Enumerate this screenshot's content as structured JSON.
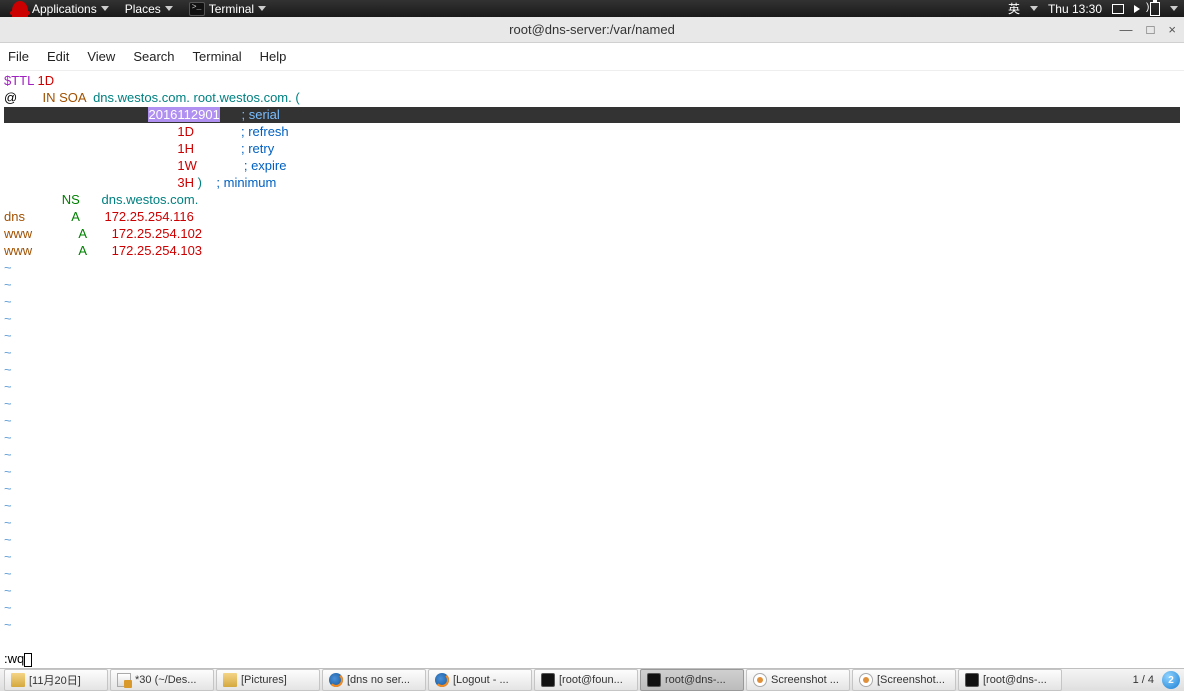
{
  "top_panel": {
    "apps": "Applications",
    "places": "Places",
    "terminal": "Terminal",
    "ime": "英",
    "clock": "Thu 13:30"
  },
  "window": {
    "title": "root@dns-server:/var/named",
    "menu": {
      "file": "File",
      "edit": "Edit",
      "view": "View",
      "search": "Search",
      "terminal": "Terminal",
      "help": "Help"
    }
  },
  "vim": {
    "l1a": "$TTL ",
    "l1b": "1D",
    "l2a": "@       ",
    "l2b": "IN SOA",
    "l2c": "  dns.westos.com. root.westos.com. (",
    "hl_pad": "                                        ",
    "hl_serial": "2016112901",
    "hl_sp": "      ",
    "hl_semi": "; ",
    "hl_word": "serial",
    "l4v": "1D",
    "l4c": "; refresh",
    "l5v": "1H",
    "l5c": "; retry",
    "l6v": "1W",
    "l6c": "; expire",
    "l7v": "3H",
    "l7p": " )    ",
    "l7c": "; minimum",
    "l8a": "                ",
    "l8b": "NS",
    "l8c": "      dns.westos.com.",
    "l9a": "dns",
    "l9p": "             ",
    "l9b": "A",
    "l9c": "       172.25.254.116",
    "l10a": "www",
    "l10p": "             ",
    "l10b": "A",
    "l10c": "       172.25.254.102",
    "l11a": "www",
    "l11p": "             ",
    "l11b": "A",
    "l11c": "       172.25.254.103",
    "indent": "                                                ",
    "status": ":wq"
  },
  "taskbar": {
    "items": [
      {
        "label": "[11月20日]",
        "icon": "folder"
      },
      {
        "label": "*30 (~/Des...",
        "icon": "gedit"
      },
      {
        "label": "[Pictures]",
        "icon": "folder"
      },
      {
        "label": "[dns no ser...",
        "icon": "ff"
      },
      {
        "label": "[Logout - ...",
        "icon": "ff"
      },
      {
        "label": "[root@foun...",
        "icon": "term"
      },
      {
        "label": "root@dns-...",
        "icon": "term",
        "active": true
      },
      {
        "label": "Screenshot ...",
        "icon": "eye"
      },
      {
        "label": "[Screenshot...",
        "icon": "eye"
      },
      {
        "label": "[root@dns-...",
        "icon": "term"
      }
    ],
    "ws": "1 / 4",
    "badge": "2"
  }
}
